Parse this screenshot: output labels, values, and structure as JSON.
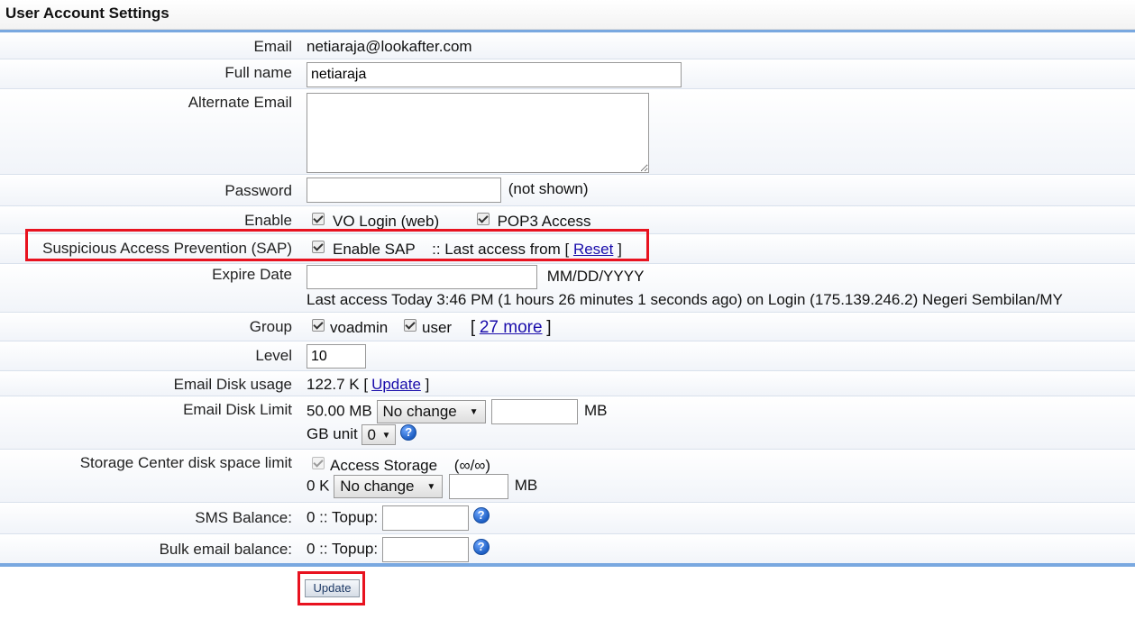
{
  "header": {
    "title": "User Account Settings"
  },
  "email": {
    "label": "Email",
    "value": "netiaraja@lookafter.com"
  },
  "fullname": {
    "label": "Full name",
    "value": "netiaraja"
  },
  "alternate_email": {
    "label": "Alternate Email",
    "value": ""
  },
  "password": {
    "label": "Password",
    "note": "(not shown)"
  },
  "enable": {
    "label": "Enable",
    "vo_login": "VO Login (web)",
    "pop3": "POP3 Access"
  },
  "sap": {
    "label": "Suspicious Access Prevention (SAP)",
    "checkbox_label": "Enable SAP",
    "last_access_prefix": ":: Last access from [",
    "reset_link": "Reset",
    "close_bracket": "]"
  },
  "expire": {
    "label": "Expire Date",
    "format": "MM/DD/YYYY",
    "last_access": "Last access Today 3:46 PM (1 hours 26 minutes 1 seconds ago) on Login (175.139.246.2) Negeri Sembilan/MY"
  },
  "group": {
    "label": "Group",
    "g1": "voadmin",
    "g2": "user",
    "open_bracket": "[",
    "more_link": "27 more",
    "close_bracket": "]"
  },
  "level": {
    "label": "Level",
    "value": "10"
  },
  "disk_usage": {
    "label": "Email Disk usage",
    "value": "122.7 K",
    "open_bracket": "[",
    "update_link": "Update",
    "close_bracket": "]"
  },
  "disk_limit": {
    "label": "Email Disk Limit",
    "value": "50.00 MB",
    "select": "No change",
    "unit": "MB",
    "gb_label": "GB unit",
    "gb_select": "0"
  },
  "storage": {
    "label": "Storage Center disk space limit",
    "checkbox_label": "Access Storage",
    "ratio": "(∞/∞)",
    "value": "0 K",
    "select": "No change",
    "unit": "MB"
  },
  "sms": {
    "label": "SMS Balance:",
    "value": "0 :: Topup:"
  },
  "bulk": {
    "label": "Bulk email balance:",
    "value": "0 :: Topup:"
  },
  "footer": {
    "update_button": "Update"
  },
  "colors": {
    "highlight": "#e8121f",
    "accent_line": "#79a8e0",
    "link": "#1a0dab"
  },
  "icons": {
    "help": "help-icon",
    "checkbox": "checkbox-checked-icon",
    "dropdown": "chevron-down-icon"
  }
}
